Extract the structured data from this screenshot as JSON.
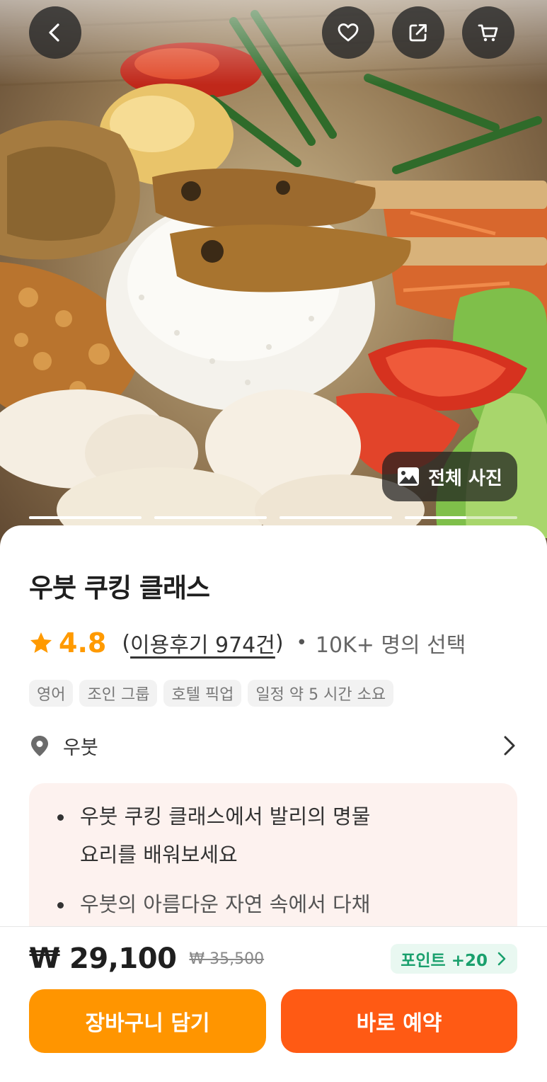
{
  "hero": {
    "all_photos_label": "전체 사진",
    "photo_count": 4,
    "current_photo_progress": 0.55,
    "icons": {
      "back": "chevron-left-icon",
      "wishlist": "heart-icon",
      "share": "share-icon",
      "cart": "cart-icon",
      "gallery": "image-icon"
    }
  },
  "product": {
    "title": "우붓 쿠킹 클래스",
    "rating": "4.8",
    "reviews_open": "(",
    "reviews_label": "이용후기 974건",
    "reviews_close": ")",
    "chosen_label": "10K+ 명의 선택",
    "tags": [
      "영어",
      "조인 그룹",
      "호텔 픽업",
      "일정 약 5 시간  소요"
    ],
    "location": "우붓",
    "highlights": [
      [
        "우붓 쿠킹 클래스에서 발리의 명물",
        "요리를 배워보세요"
      ],
      [
        "우붓의 아름다운 자연 속에서 다채"
      ]
    ]
  },
  "purchase": {
    "price": "₩ 29,100",
    "original_price": "₩ 35,500",
    "points_label": "포인트 +20",
    "add_to_cart_label": "장바구니 담기",
    "book_now_label": "바로 예약"
  },
  "colors": {
    "rating": "#ff9a00",
    "cart_button": "#ff9500",
    "book_button": "#ff5a14",
    "points": "#1aa06d",
    "highlights_bg": "#fdf2ef"
  }
}
